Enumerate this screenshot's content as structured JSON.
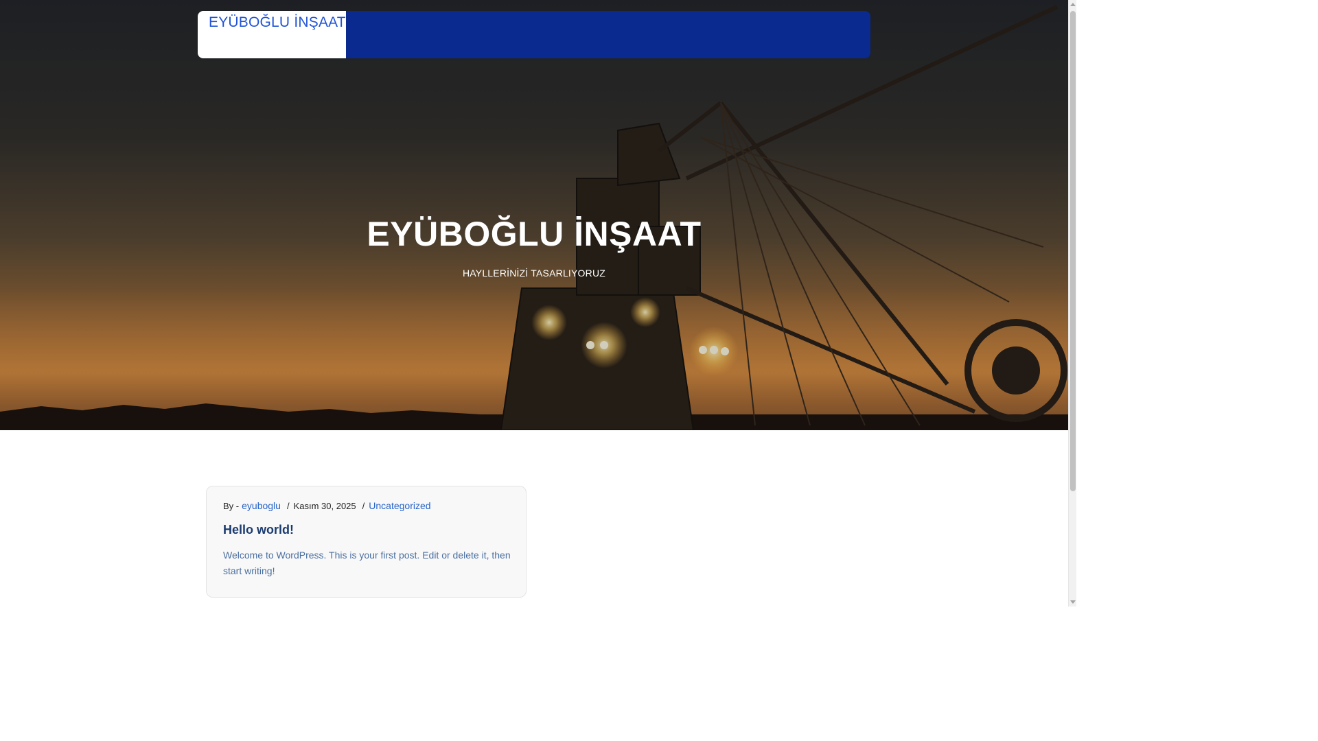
{
  "header": {
    "logo_text": "EYÜBOĞLU İNŞAAT"
  },
  "hero": {
    "title": "EYÜBOĞLU İNŞAAT",
    "tagline": "HAYLLERİNİZİ TASARLIYORUZ"
  },
  "post": {
    "by_label": "By -",
    "author": "eyuboglu",
    "separator": "/",
    "date": "Kasım 30, 2025",
    "category": "Uncategorized",
    "title": "Hello world!",
    "excerpt": "Welcome to WordPress. This is your first post. Edit or delete it, then start writing!"
  },
  "colors": {
    "nav_background": "#0a2a8f",
    "logo_text": "#2154d6",
    "link": "#2563c9",
    "post_title": "#1b3b6f",
    "excerpt": "#4a6fa1"
  }
}
